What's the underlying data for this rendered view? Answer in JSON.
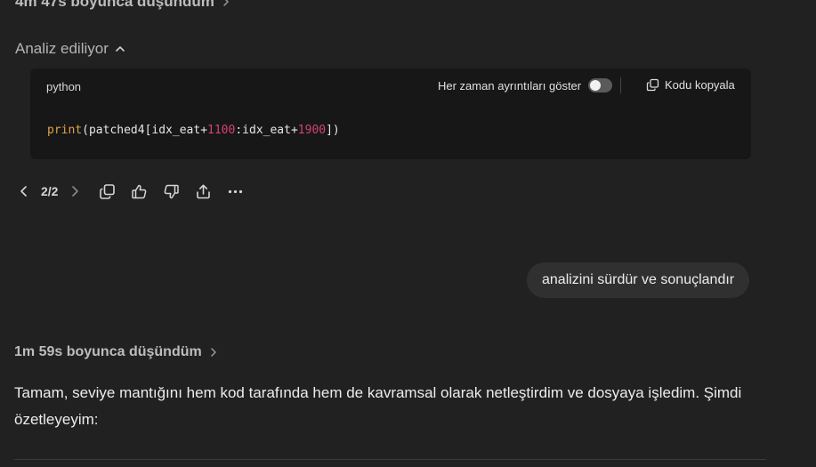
{
  "thought_top": {
    "label": "4m 47s boyunca düşündüm"
  },
  "analysis": {
    "label": "Analiz ediliyor"
  },
  "code_block": {
    "language": "python",
    "toggle_label": "Her zaman ayrıntıları göster",
    "toggle_on": false,
    "copy_label": "Kodu kopyala",
    "code": {
      "fn": "print",
      "part1": "(patched4[idx_eat+",
      "num1": "1100",
      "part2": ":idx_eat+",
      "num2": "1900",
      "part3": "])"
    }
  },
  "actions": {
    "pager": "2/2",
    "icons": [
      "chevron-left-icon",
      "chevron-right-icon",
      "copy-icon",
      "thumbs-up-icon",
      "thumbs-down-icon",
      "share-icon",
      "more-icon"
    ]
  },
  "user_message": {
    "text": "analizini sürdür ve sonuçlandır"
  },
  "thought_bottom": {
    "label": "1m 59s boyunca düşündüm"
  },
  "response": {
    "text": "Tamam, seviye mantığını hem kod tarafında hem de kavramsal olarak netleştirdim ve dosyaya işledim. Şimdi özetleyeyim:"
  },
  "colors": {
    "background": "#212121",
    "code_bg": "#171717",
    "bubble_bg": "#303030",
    "number": "#d4427a",
    "function": "#e0a34a"
  }
}
